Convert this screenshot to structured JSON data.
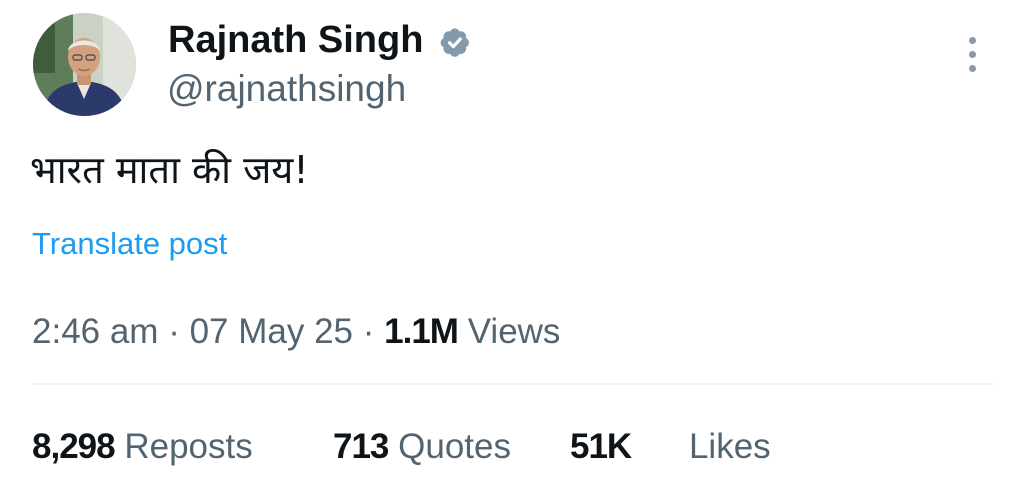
{
  "author": {
    "display_name": "Rajnath Singh",
    "handle": "@rajnathsingh",
    "verified": true,
    "verified_color": "#829aab"
  },
  "post": {
    "text": "भारत माता की जय!",
    "translate_label": "Translate post"
  },
  "meta": {
    "time": "2:46 am",
    "separator": "·",
    "date": "07 May 25",
    "views_count": "1.1M",
    "views_label": "Views"
  },
  "stats": {
    "reposts_count": "8,298",
    "reposts_label": "Reposts",
    "quotes_count": "713",
    "quotes_label": "Quotes",
    "likes_count": "51K",
    "likes_label": "Likes"
  },
  "icons": {
    "more": "more-options-icon",
    "verified": "verified-badge-icon"
  },
  "colors": {
    "text_primary": "#0f1419",
    "text_secondary": "#536471",
    "link": "#1d9bf0",
    "divider": "#eff3f4"
  }
}
